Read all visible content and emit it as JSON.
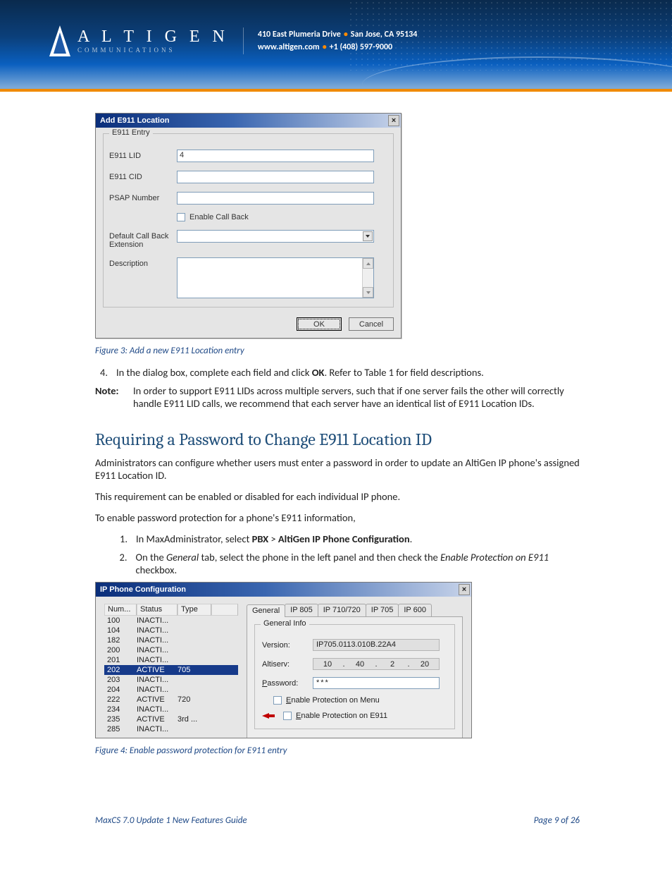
{
  "header": {
    "brand_main": "A L T I G E N",
    "brand_sub": "COMMUNICATIONS",
    "address": "410 East Plumeria Drive",
    "city": "San Jose, CA 95134",
    "site": "www.altigen.com",
    "phone": "+1 (408) 597-9000"
  },
  "dialog1": {
    "title": "Add E911 Location",
    "close": "×",
    "group_label": "E911 Entry",
    "lid_label": "E911 LID",
    "lid_value": "4",
    "cid_label": "E911 CID",
    "cid_value": "",
    "psap_label": "PSAP Number",
    "psap_value": "",
    "cb_label": "Enable Call Back",
    "ext_label": "Default Call Back Extension",
    "desc_label": "Description",
    "ok": "OK",
    "cancel": "Cancel"
  },
  "fig3": "Figure 3: Add a new E911 Location entry",
  "step4_num": "4.",
  "step4_a": "In the dialog box, complete each field and click ",
  "step4_b": "OK",
  "step4_c": ". Refer to Table 1 for field descriptions.",
  "note_label": "Note:",
  "note_text": "In order to support E911 LIDs across multiple servers, such that if one server fails the other will correctly handle E911 LID calls, we recommend that each server have an identical list of E911 Location IDs.",
  "section_title": "Requiring a Password to Change E911 Location ID",
  "para1": "Administrators can configure whether users must enter a password in order to update an AltiGen IP phone's assigned E911 Location ID.",
  "para2": "This requirement can be enabled or disabled for each individual IP phone.",
  "para3": "To enable password protection for a phone's E911 information,",
  "s1_num": "1.",
  "s1_a": "In MaxAdministrator, select ",
  "s1_b": "PBX",
  "s1_c": " > ",
  "s1_d": "AltiGen IP Phone Configuration",
  "s1_e": ".",
  "s2_num": "2.",
  "s2_a": "On the ",
  "s2_b": "General",
  "s2_c": " tab, select the phone in the left panel and then check the ",
  "s2_d": "Enable Protection on E911",
  "s2_e": " checkbox.",
  "dialog2": {
    "title": "IP Phone Configuration",
    "close": "×",
    "cols": {
      "c1": "Num...",
      "c2": "Status",
      "c3": "Type"
    },
    "rows": [
      {
        "num": "100",
        "status": "INACTI...",
        "type": ""
      },
      {
        "num": "104",
        "status": "INACTI...",
        "type": ""
      },
      {
        "num": "182",
        "status": "INACTI...",
        "type": ""
      },
      {
        "num": "200",
        "status": "INACTI...",
        "type": ""
      },
      {
        "num": "201",
        "status": "INACTI...",
        "type": ""
      },
      {
        "num": "202",
        "status": "ACTIVE",
        "type": "705",
        "sel": true
      },
      {
        "num": "203",
        "status": "INACTI...",
        "type": ""
      },
      {
        "num": "204",
        "status": "INACTI...",
        "type": ""
      },
      {
        "num": "222",
        "status": "ACTIVE",
        "type": "720"
      },
      {
        "num": "234",
        "status": "INACTI...",
        "type": ""
      },
      {
        "num": "235",
        "status": "ACTIVE",
        "type": "3rd ..."
      },
      {
        "num": "285",
        "status": "INACTI...",
        "type": ""
      }
    ],
    "tabs": [
      "General",
      "IP 805",
      "IP 710/720",
      "IP 705",
      "IP 600"
    ],
    "active_tab": 0,
    "gi_label": "General Info",
    "ver_label": "Version:",
    "ver_value": "IP705.0113.010B.22A4",
    "alti_label": "Altiserv:",
    "ip": [
      "10",
      "40",
      "2",
      "20"
    ],
    "pw_label_u": "P",
    "pw_label_rest": "assword:",
    "pw_value": "***",
    "chk_menu_u": "E",
    "chk_menu_rest": "nable Protection on Menu",
    "chk_e911_u": "E",
    "chk_e911_rest": "nable Protection on E911"
  },
  "fig4": "Figure 4: Enable password protection for E911 entry",
  "footer": {
    "left": "MaxCS 7.0 Update 1 New Features Guide",
    "right": "Page 9 of 26"
  }
}
